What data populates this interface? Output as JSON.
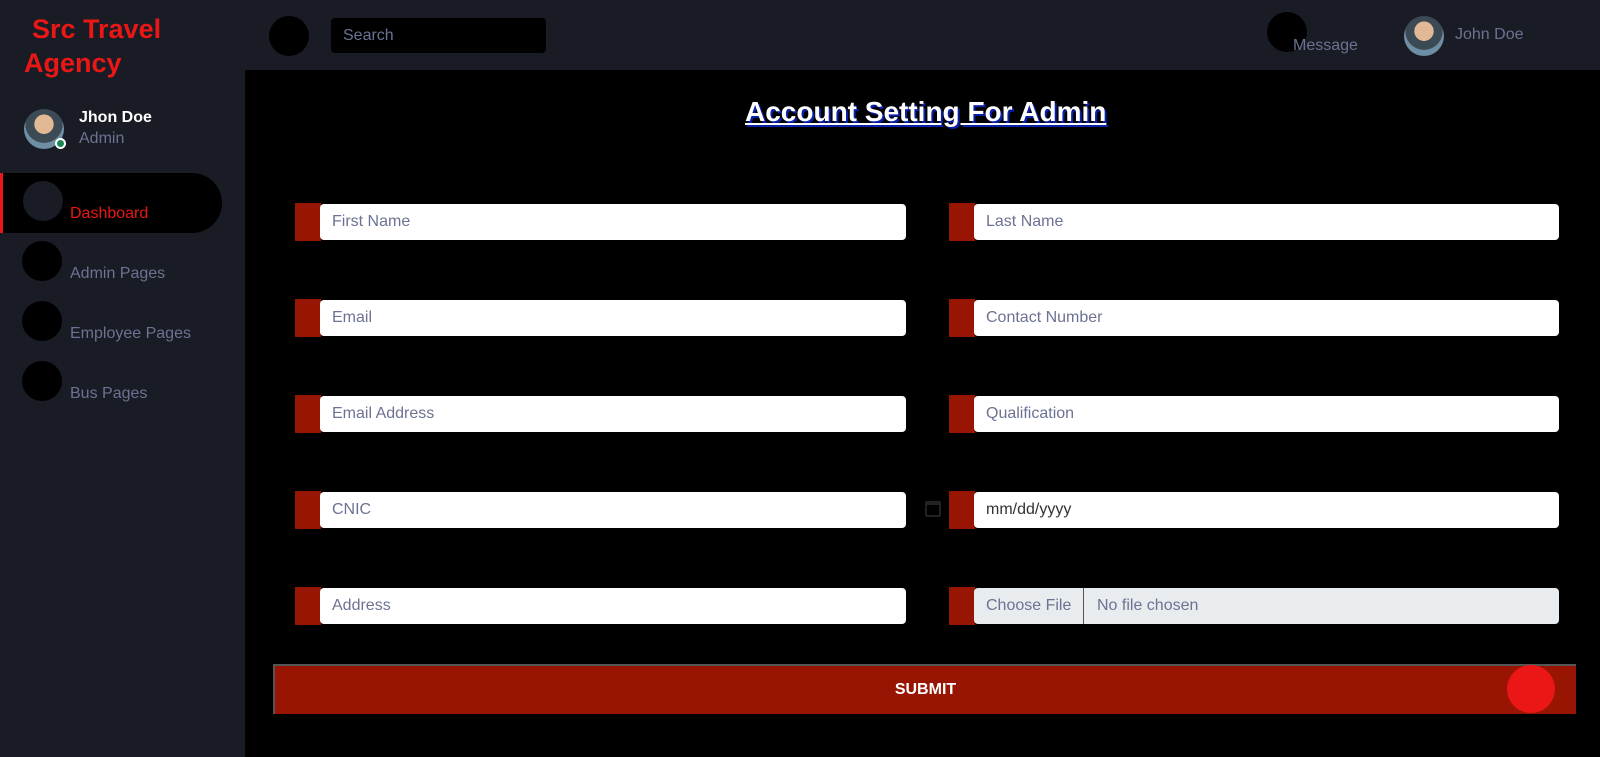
{
  "brand": {
    "line1": "Src Travel",
    "line2": "Agency"
  },
  "profile": {
    "name": "Jhon Doe",
    "role": "Admin"
  },
  "sidebar": {
    "items": [
      {
        "label": "Dashboard",
        "caret": ""
      },
      {
        "label": "Admin Pages",
        "caret": ""
      },
      {
        "label": "Employee Pages",
        "caret": ""
      },
      {
        "label": "Bus Pages",
        "caret": ""
      }
    ]
  },
  "topbar": {
    "search_placeholder": "Search",
    "message_label": "Message",
    "message_caret": "",
    "user_name": "John Doe",
    "user_caret": ""
  },
  "page": {
    "title": "Account Setting For Admin"
  },
  "form": {
    "first_name": "First Name",
    "last_name": "Last Name",
    "email": "Email",
    "contact_number": "Contact Number",
    "email_address": "Email Address",
    "qualification": "Qualification",
    "cnic": "CNIC",
    "date_placeholder": "mm/dd/yyyy",
    "address": "Address",
    "file_button": "Choose File",
    "file_status": "No file chosen",
    "submit_label": "SUBMIT"
  },
  "colors": {
    "accent": "#eb1616",
    "field_stub": "#991503",
    "sidebar_bg": "#191c24"
  }
}
